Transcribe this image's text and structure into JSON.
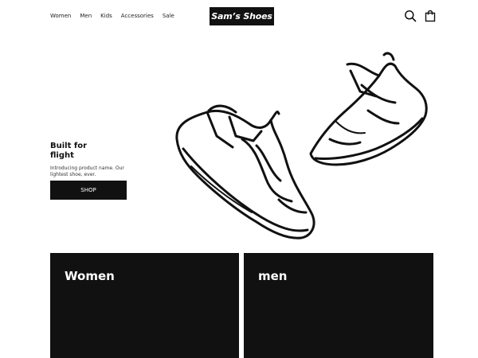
{
  "nav": {
    "items": [
      {
        "label": "Women"
      },
      {
        "label": "Men"
      },
      {
        "label": "Kids"
      },
      {
        "label": "Accessories"
      },
      {
        "label": "Sale"
      }
    ]
  },
  "brand": {
    "logo_text": "Sam’s Shoes"
  },
  "header_icons": {
    "search": "search-icon",
    "cart": "shopping-bag-icon"
  },
  "hero": {
    "title": "Built for flight",
    "subtitle": "Introducing product name. Our lightest shoe, ever.",
    "cta_label": "SHOP"
  },
  "categories": [
    {
      "label": "Women"
    },
    {
      "label": "men"
    }
  ],
  "colors": {
    "primary": "#111111",
    "background": "#ffffff",
    "text_on_dark": "#ffffff"
  }
}
